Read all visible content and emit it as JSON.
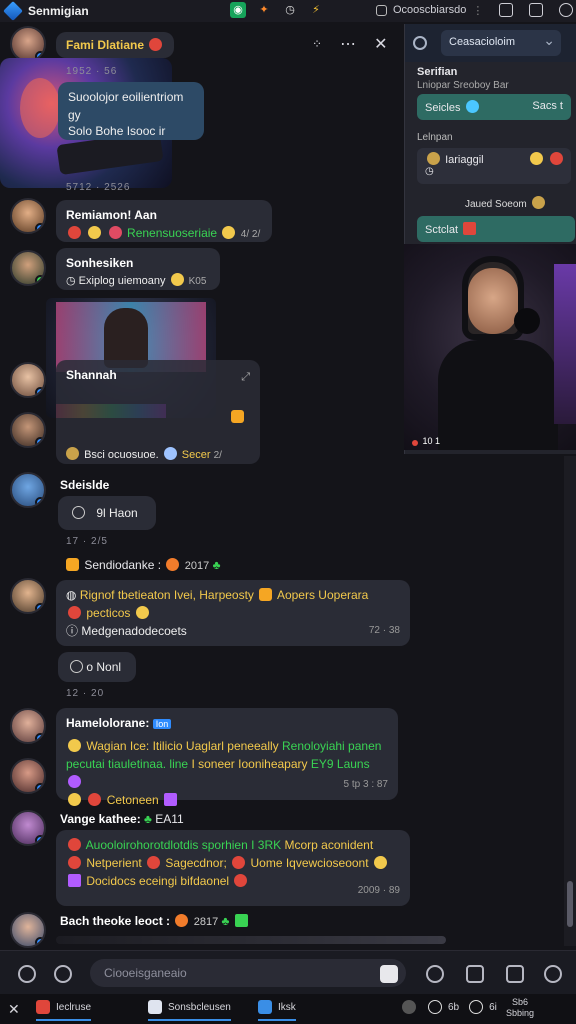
{
  "window": {
    "title": "Senmigian"
  },
  "topbar": {
    "account_label": "Ocooscbiarsdo"
  },
  "chat": {
    "messages": [
      {
        "sender": "Fami Dlatiane",
        "image_timestamp": "1952 · 56",
        "image_caption_timestamp": "5712 · 2526"
      },
      {
        "text": "Suoolojor eoilientriom",
        "line2": "gy",
        "line3": "Solo Bohe Isooc ir"
      },
      {
        "sender": "Remiamon! Aan",
        "text": "Renensuoseriaie",
        "time": "4/ 2/"
      },
      {
        "sender": "Sonhesiken",
        "text": "Exiplog uiemoany",
        "time": "K05"
      },
      {
        "sender": "Shannah",
        "caption": "Bsci ocuosuoe.",
        "caption2": "Secer",
        "caption_time": "2/"
      },
      {
        "sender": "Sdeislde",
        "text": "9l Haon",
        "time": "17 · 2/5"
      },
      {
        "sender": "Sendiodanke :",
        "time": "2017"
      },
      {
        "line1": "Rignof tbetieaton Ivei, Harpeosty",
        "line1b": "Aopers Uoperara",
        "line2": "pecticos",
        "line3": "Medgenadodecoets",
        "time": "72 · 38"
      },
      {
        "text": "o Nonl",
        "time": "12 · 20"
      },
      {
        "sender": "Hamelolorane:",
        "badge": "Ion",
        "line1a": "Wagian Ice: Itilicio Uaglarl peneeally",
        "line1b": "Renoloyiahi panen",
        "line2a": "pecutai tiauletinaa. line",
        "line2b": "I soneer Iooniheapary",
        "line2c": "EY9 Launs",
        "line3": "Cetoneen",
        "time": "5 tp 3 : 87"
      },
      {
        "sender": "Vange kathee:",
        "tag": "EA11"
      },
      {
        "line1": "Auooloirohorotdlotdis sporhien I 3RK",
        "line1b": "Mcorp aconident",
        "line2a": "Netperient",
        "line2b": "Sagecdnor;",
        "line2c": "Uome Iqvewcioseoont",
        "line3": "Docidocs eceingi bifdaonel",
        "time": "2009 · 89"
      },
      {
        "sender": "Bach theoke leoct :",
        "time": "2817"
      }
    ]
  },
  "side_panel": {
    "search_value": "Ceasacioloim",
    "section_title": "Serifian",
    "section_subtitle": "Lniopar Sreoboy Bar",
    "pill1": "Seicles",
    "pill1_time": "Sacs t",
    "group_label": "Lelnpan",
    "item1": "Iariaggil",
    "item2": "Jaued Soeom",
    "pill2": "Sctclat",
    "video_time": "10 1"
  },
  "composer": {
    "placeholder": "Ciooeisganeaio"
  },
  "taskbar": {
    "items": [
      "Ieclruse",
      "Sonsbcleusen",
      "Iksk"
    ],
    "clock_1": "6b",
    "clock_2": "6i",
    "tray_label": "Sb6 Sbbing"
  },
  "colors": {
    "accent_green": "#39d353",
    "accent_blue": "#2f8cff",
    "bubble": "#2a2c36",
    "background": "#141419"
  }
}
